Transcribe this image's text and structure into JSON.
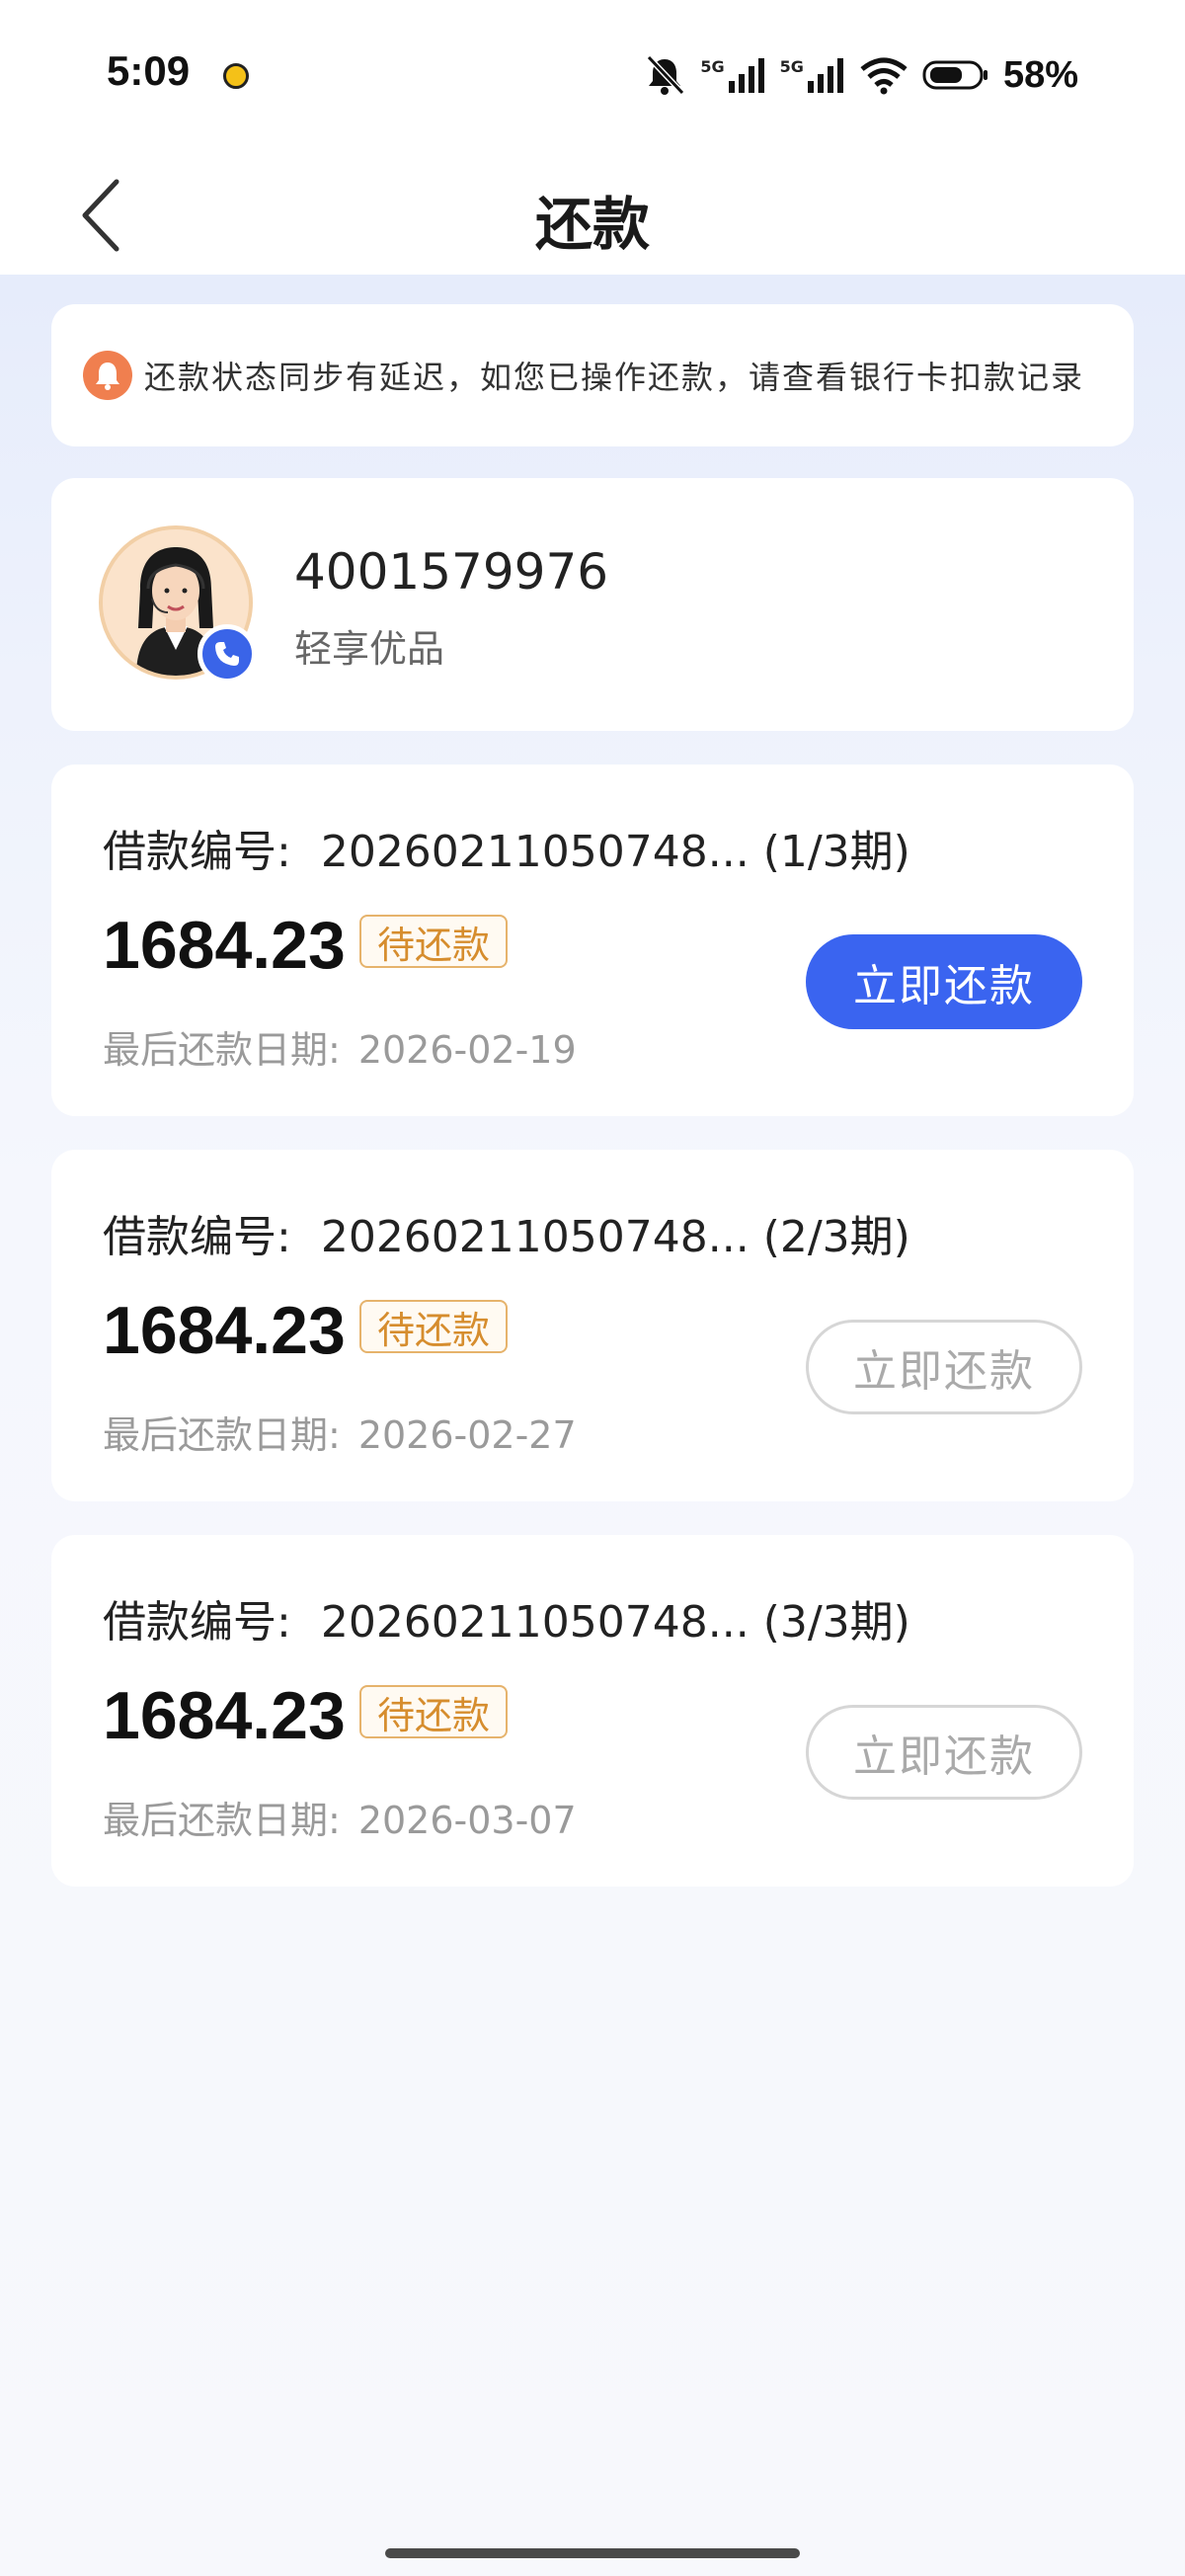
{
  "status_bar": {
    "time": "5:09",
    "network_1": "5G",
    "network_2": "5G",
    "battery": "58%"
  },
  "header": {
    "title": "还款"
  },
  "notice": {
    "text": "还款状态同步有延迟，如您已操作还款，请查看银行卡扣款记录",
    "icon": "bell-icon"
  },
  "contact": {
    "number": "4001579976",
    "name": "轻享优品",
    "avatar_icon": "customer-service-avatar",
    "badge_icon": "phone-icon"
  },
  "loans": [
    {
      "no_label": "借款编号:",
      "no_value": "20260211050748... (1/3期)",
      "amount": "1684.23",
      "status": "待还款",
      "due_label": "最后还款日期:",
      "due_date": "2026-02-19",
      "button": "立即还款",
      "button_state": "active"
    },
    {
      "no_label": "借款编号:",
      "no_value": "20260211050748... (2/3期)",
      "amount": "1684.23",
      "status": "待还款",
      "due_label": "最后还款日期:",
      "due_date": "2026-02-27",
      "button": "立即还款",
      "button_state": "disabled"
    },
    {
      "no_label": "借款编号:",
      "no_value": "20260211050748... (3/3期)",
      "amount": "1684.23",
      "status": "待还款",
      "due_label": "最后还款日期:",
      "due_date": "2026-03-07",
      "button": "立即还款",
      "button_state": "disabled"
    }
  ],
  "colors": {
    "primary": "#3a64f0",
    "status_tag": "#d68d2e",
    "bell": "#f07f4f"
  }
}
